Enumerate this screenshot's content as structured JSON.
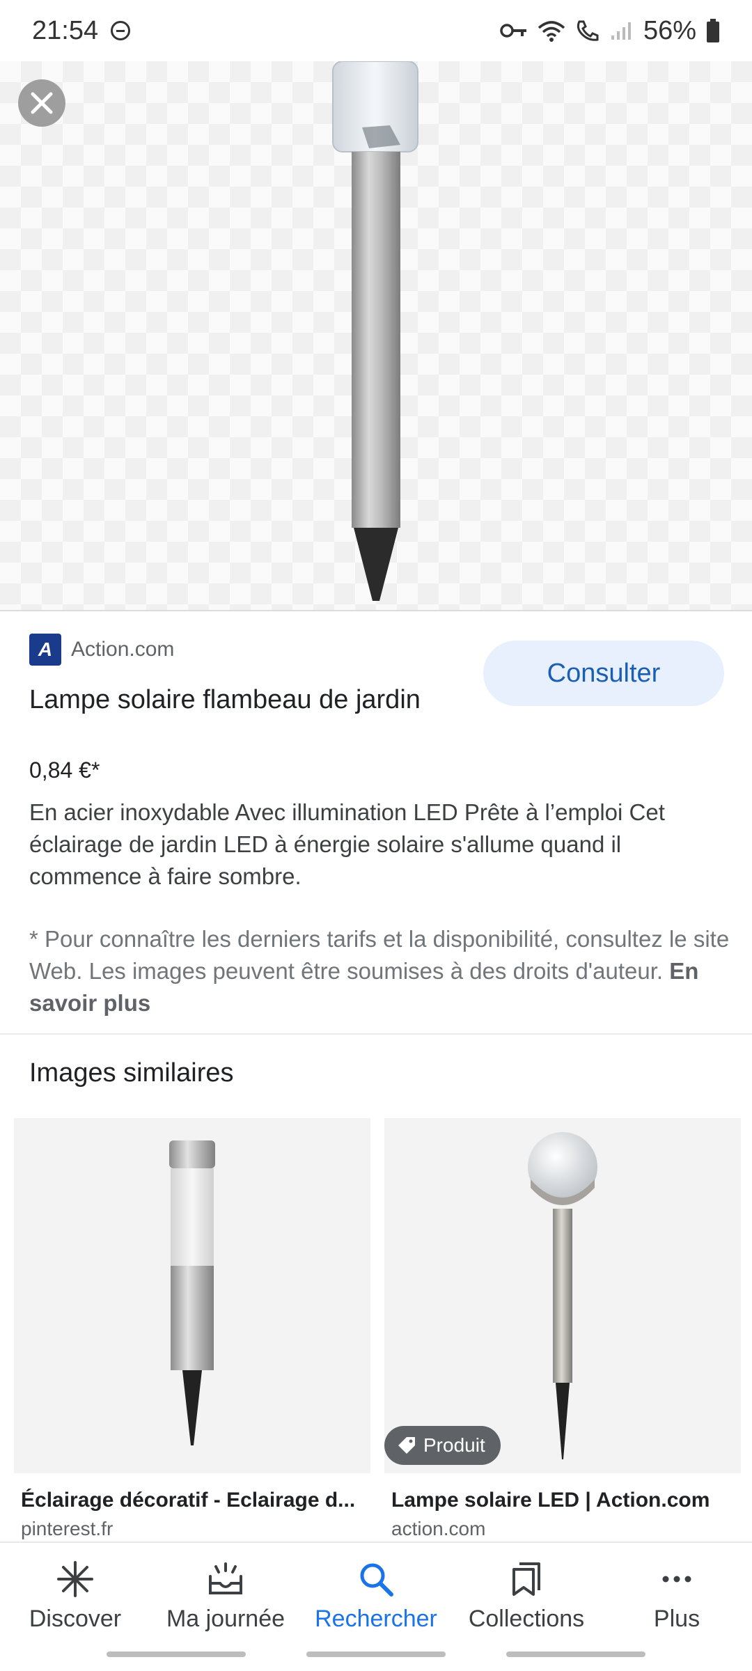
{
  "status_bar": {
    "time": "21:54",
    "battery": "56%"
  },
  "product": {
    "source": "Action.com",
    "logo_text": "A",
    "consult_label": "Consulter",
    "title": "Lampe solaire flambeau de jardin",
    "price": "0,84 €*",
    "description": "En acier inoxydable Avec illumination LED Prête à l’emploi Cet éclairage de jardin LED à énergie solaire s'allume quand il commence à faire sombre.",
    "note": "* Pour connaître les derniers tarifs et la disponibilité, consultez le site Web. Les images peuvent être soumises à des droits d'auteur.",
    "learn_more": "En savoir plus"
  },
  "similar": {
    "title": "Images similaires",
    "items": [
      {
        "caption": "Éclairage décoratif - Eclairage d...",
        "domain": "pinterest.fr"
      },
      {
        "caption": "Lampe solaire LED | Action.com",
        "domain": "action.com",
        "badge": "Produit"
      }
    ]
  },
  "nav": {
    "items": [
      {
        "label": "Discover",
        "icon": "asterisk-icon"
      },
      {
        "label": "Ma journée",
        "icon": "inbox-icon"
      },
      {
        "label": "Rechercher",
        "icon": "search-icon"
      },
      {
        "label": "Collections",
        "icon": "bookmarks-icon"
      },
      {
        "label": "Plus",
        "icon": "more-icon"
      }
    ],
    "active_index": 2
  },
  "colors": {
    "accent": "#1a73e8",
    "consult_bg": "#e8f0fe",
    "logo_blue": "#1a3a8c"
  }
}
